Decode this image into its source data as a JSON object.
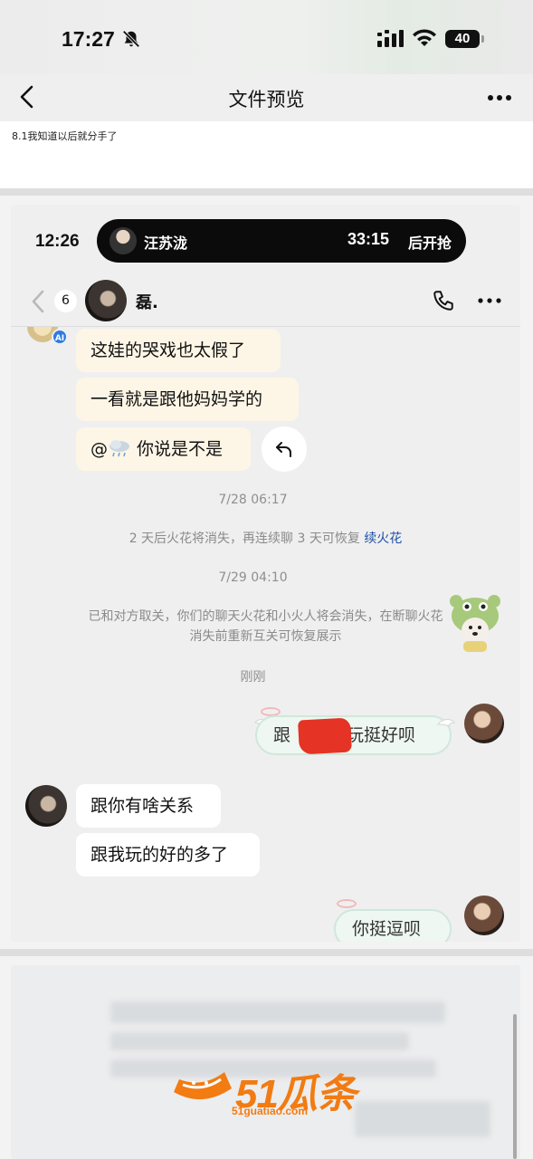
{
  "status_bar": {
    "time": "17:27",
    "battery": "40"
  },
  "nav": {
    "title": "文件预览"
  },
  "caption": "8.1我知道以后就分手了",
  "card": {
    "time": "12:26",
    "call": {
      "name": "汪苏泷",
      "timer": "33:15",
      "tail_text": "后开抢"
    },
    "chat": {
      "unread_count": "6",
      "contact_name": "磊.",
      "ai_badge": "AI",
      "messages_in_1": [
        "这娃的哭戏也太假了",
        "一看就是跟他妈妈学的"
      ],
      "mention_message": {
        "prefix": "@",
        "text": "你说是不是"
      },
      "timestamp_1": "7/28 06:17",
      "system_1": {
        "text": "2 天后火花将消失，再连续聊 3 天可恢复",
        "link": "续火花"
      },
      "timestamp_2": "7/29 04:10",
      "system_2_line1": "已和对方取关，你们的聊天火花和小火人将会消失，在断聊火花",
      "system_2_line2": "消失前重新互关可恢复展示",
      "timestamp_3": "刚刚",
      "out_message_1": {
        "before": "跟",
        "after": "玩挺好呗"
      },
      "messages_in_2": [
        "跟你有啥关系",
        "跟我玩的好的多了"
      ],
      "out_message_2": "你挺逗呗"
    }
  },
  "watermark": {
    "brand": "51瓜条",
    "url": "51guatiao.com"
  },
  "colors": {
    "accent_link": "#1e4ea8",
    "bubble_in": "#fdf6e6",
    "redaction": "#e53325",
    "watermark": "#f27b12"
  }
}
